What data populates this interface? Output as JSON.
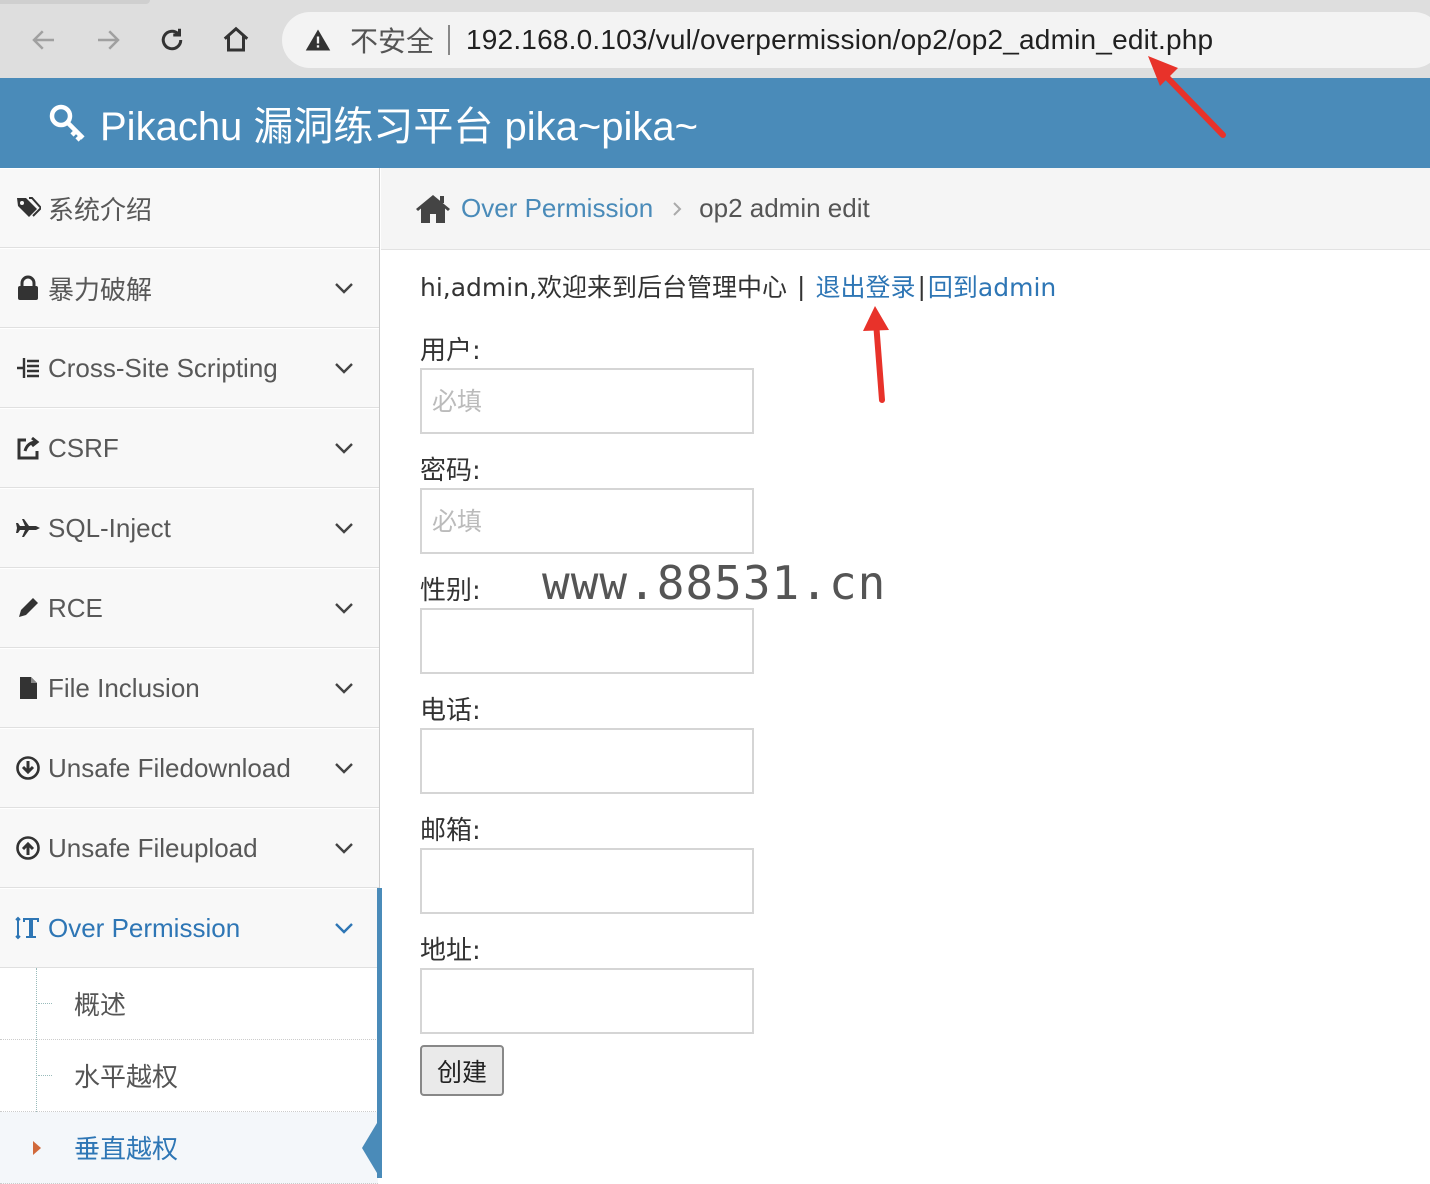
{
  "browser": {
    "back_icon": "arrow-left-icon",
    "forward_icon": "arrow-right-icon",
    "reload_icon": "reload-icon",
    "home_icon": "home-icon",
    "security_label": "不安全",
    "url": "192.168.0.103/vul/overpermission/op2/op2_admin_edit.php"
  },
  "header": {
    "title": "Pikachu 漏洞练习平台 pika~pika~",
    "icon": "key-icon",
    "color": "#4a8bb9"
  },
  "sidebar": {
    "items": [
      {
        "label": "系统介绍",
        "icon": "tags-icon"
      },
      {
        "label": "暴力破解",
        "icon": "lock-icon"
      },
      {
        "label": "Cross-Site Scripting",
        "icon": "list-tree-icon"
      },
      {
        "label": "CSRF",
        "icon": "share-square-icon"
      },
      {
        "label": "SQL-Inject",
        "icon": "plane-icon"
      },
      {
        "label": "RCE",
        "icon": "pencil-icon"
      },
      {
        "label": "File Inclusion",
        "icon": "file-icon"
      },
      {
        "label": "Unsafe Filedownload",
        "icon": "download-circle-icon"
      },
      {
        "label": "Unsafe Fileupload",
        "icon": "upload-circle-icon"
      },
      {
        "label": "Over Permission",
        "icon": "text-height-icon",
        "active": true
      }
    ],
    "submenu": [
      {
        "label": "概述"
      },
      {
        "label": "水平越权"
      },
      {
        "label": "垂直越权",
        "current": true
      }
    ]
  },
  "breadcrumb": {
    "link": "Over Permission",
    "current": "op2 admin edit"
  },
  "welcome": {
    "text": "hi,admin,欢迎来到后台管理中心",
    "separator": "|",
    "logout": "退出登录",
    "separator2": "|",
    "back": "回到admin"
  },
  "form": {
    "fields": [
      {
        "label": "用户:",
        "placeholder": "必填"
      },
      {
        "label": "密码:",
        "placeholder": "必填"
      },
      {
        "label": "性别:",
        "placeholder": ""
      },
      {
        "label": "电话:",
        "placeholder": ""
      },
      {
        "label": "邮箱:",
        "placeholder": ""
      },
      {
        "label": "地址:",
        "placeholder": ""
      }
    ],
    "submit": "创建"
  },
  "watermark": "www.88531.cn",
  "annotation_color": "#e8322a"
}
